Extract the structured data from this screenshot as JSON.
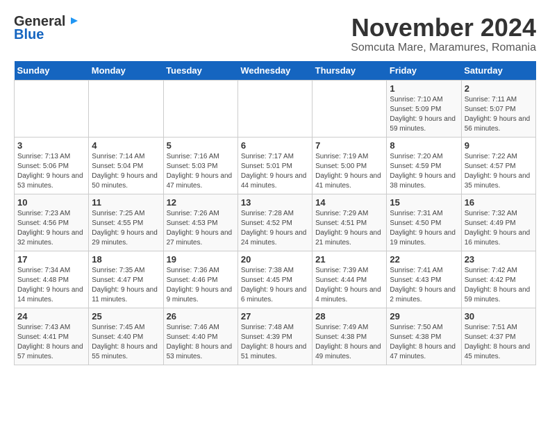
{
  "logo": {
    "line1": "General",
    "line2": "Blue"
  },
  "title": "November 2024",
  "location": "Somcuta Mare, Maramures, Romania",
  "days_of_week": [
    "Sunday",
    "Monday",
    "Tuesday",
    "Wednesday",
    "Thursday",
    "Friday",
    "Saturday"
  ],
  "weeks": [
    [
      {
        "day": "",
        "info": ""
      },
      {
        "day": "",
        "info": ""
      },
      {
        "day": "",
        "info": ""
      },
      {
        "day": "",
        "info": ""
      },
      {
        "day": "",
        "info": ""
      },
      {
        "day": "1",
        "info": "Sunrise: 7:10 AM\nSunset: 5:09 PM\nDaylight: 9 hours and 59 minutes."
      },
      {
        "day": "2",
        "info": "Sunrise: 7:11 AM\nSunset: 5:07 PM\nDaylight: 9 hours and 56 minutes."
      }
    ],
    [
      {
        "day": "3",
        "info": "Sunrise: 7:13 AM\nSunset: 5:06 PM\nDaylight: 9 hours and 53 minutes."
      },
      {
        "day": "4",
        "info": "Sunrise: 7:14 AM\nSunset: 5:04 PM\nDaylight: 9 hours and 50 minutes."
      },
      {
        "day": "5",
        "info": "Sunrise: 7:16 AM\nSunset: 5:03 PM\nDaylight: 9 hours and 47 minutes."
      },
      {
        "day": "6",
        "info": "Sunrise: 7:17 AM\nSunset: 5:01 PM\nDaylight: 9 hours and 44 minutes."
      },
      {
        "day": "7",
        "info": "Sunrise: 7:19 AM\nSunset: 5:00 PM\nDaylight: 9 hours and 41 minutes."
      },
      {
        "day": "8",
        "info": "Sunrise: 7:20 AM\nSunset: 4:59 PM\nDaylight: 9 hours and 38 minutes."
      },
      {
        "day": "9",
        "info": "Sunrise: 7:22 AM\nSunset: 4:57 PM\nDaylight: 9 hours and 35 minutes."
      }
    ],
    [
      {
        "day": "10",
        "info": "Sunrise: 7:23 AM\nSunset: 4:56 PM\nDaylight: 9 hours and 32 minutes."
      },
      {
        "day": "11",
        "info": "Sunrise: 7:25 AM\nSunset: 4:55 PM\nDaylight: 9 hours and 29 minutes."
      },
      {
        "day": "12",
        "info": "Sunrise: 7:26 AM\nSunset: 4:53 PM\nDaylight: 9 hours and 27 minutes."
      },
      {
        "day": "13",
        "info": "Sunrise: 7:28 AM\nSunset: 4:52 PM\nDaylight: 9 hours and 24 minutes."
      },
      {
        "day": "14",
        "info": "Sunrise: 7:29 AM\nSunset: 4:51 PM\nDaylight: 9 hours and 21 minutes."
      },
      {
        "day": "15",
        "info": "Sunrise: 7:31 AM\nSunset: 4:50 PM\nDaylight: 9 hours and 19 minutes."
      },
      {
        "day": "16",
        "info": "Sunrise: 7:32 AM\nSunset: 4:49 PM\nDaylight: 9 hours and 16 minutes."
      }
    ],
    [
      {
        "day": "17",
        "info": "Sunrise: 7:34 AM\nSunset: 4:48 PM\nDaylight: 9 hours and 14 minutes."
      },
      {
        "day": "18",
        "info": "Sunrise: 7:35 AM\nSunset: 4:47 PM\nDaylight: 9 hours and 11 minutes."
      },
      {
        "day": "19",
        "info": "Sunrise: 7:36 AM\nSunset: 4:46 PM\nDaylight: 9 hours and 9 minutes."
      },
      {
        "day": "20",
        "info": "Sunrise: 7:38 AM\nSunset: 4:45 PM\nDaylight: 9 hours and 6 minutes."
      },
      {
        "day": "21",
        "info": "Sunrise: 7:39 AM\nSunset: 4:44 PM\nDaylight: 9 hours and 4 minutes."
      },
      {
        "day": "22",
        "info": "Sunrise: 7:41 AM\nSunset: 4:43 PM\nDaylight: 9 hours and 2 minutes."
      },
      {
        "day": "23",
        "info": "Sunrise: 7:42 AM\nSunset: 4:42 PM\nDaylight: 8 hours and 59 minutes."
      }
    ],
    [
      {
        "day": "24",
        "info": "Sunrise: 7:43 AM\nSunset: 4:41 PM\nDaylight: 8 hours and 57 minutes."
      },
      {
        "day": "25",
        "info": "Sunrise: 7:45 AM\nSunset: 4:40 PM\nDaylight: 8 hours and 55 minutes."
      },
      {
        "day": "26",
        "info": "Sunrise: 7:46 AM\nSunset: 4:40 PM\nDaylight: 8 hours and 53 minutes."
      },
      {
        "day": "27",
        "info": "Sunrise: 7:48 AM\nSunset: 4:39 PM\nDaylight: 8 hours and 51 minutes."
      },
      {
        "day": "28",
        "info": "Sunrise: 7:49 AM\nSunset: 4:38 PM\nDaylight: 8 hours and 49 minutes."
      },
      {
        "day": "29",
        "info": "Sunrise: 7:50 AM\nSunset: 4:38 PM\nDaylight: 8 hours and 47 minutes."
      },
      {
        "day": "30",
        "info": "Sunrise: 7:51 AM\nSunset: 4:37 PM\nDaylight: 8 hours and 45 minutes."
      }
    ]
  ]
}
